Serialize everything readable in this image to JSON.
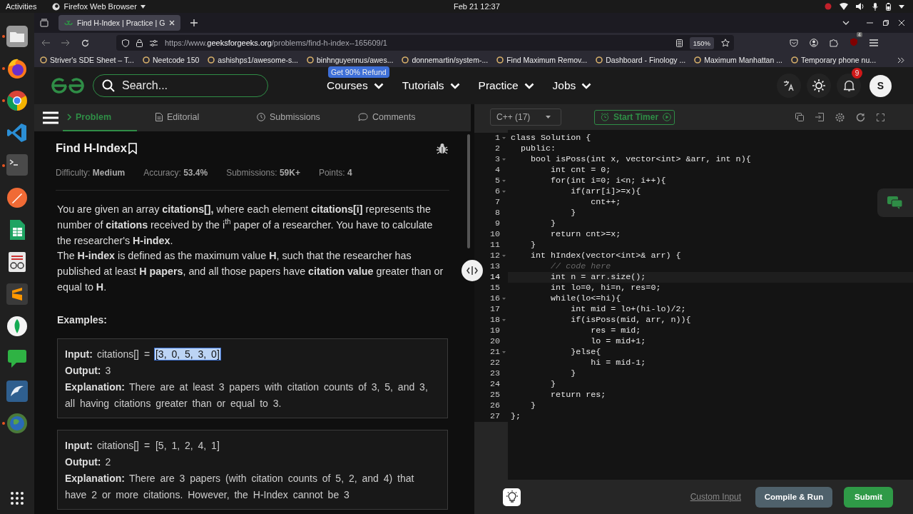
{
  "system_bar": {
    "activities": "Activities",
    "app_menu": "Firefox Web Browser",
    "clock": "Feb 21  12:37"
  },
  "dock": [
    {
      "kind": "folder",
      "running": true
    },
    {
      "kind": "flame",
      "running": true
    },
    {
      "kind": "wheel",
      "running": true
    },
    {
      "kind": "ribbon",
      "running": false
    },
    {
      "kind": "terminal",
      "running": true
    },
    {
      "kind": "rocket",
      "running": false
    },
    {
      "kind": "sheet",
      "running": false
    },
    {
      "kind": "glasses",
      "running": false
    },
    {
      "kind": "stripes",
      "running": false
    },
    {
      "kind": "leaf",
      "running": false
    },
    {
      "kind": "chat",
      "running": false
    },
    {
      "kind": "dolphin",
      "running": false
    },
    {
      "kind": "globe",
      "running": true
    }
  ],
  "browser": {
    "tab_title": "Find H-Index | Practice | G",
    "url_host": "https://www.",
    "url_domain": "geeksforgeeks.org",
    "url_path": "/problems/find-h-index--165609/1",
    "zoom": "150%",
    "extension_badge": "4",
    "bookmarks": [
      {
        "label": "Striver's SDE Sheet – T..."
      },
      {
        "label": "Neetcode 150"
      },
      {
        "label": "ashishps1/awesome-s..."
      },
      {
        "label": "binhnguyennus/awes..."
      },
      {
        "label": "donnemartin/system-..."
      },
      {
        "label": "Find Maximum Remov..."
      },
      {
        "label": "Dashboard - Finology ..."
      },
      {
        "label": "Maximum Manhattan ..."
      },
      {
        "label": "Temporary phone nu..."
      }
    ]
  },
  "site_header": {
    "search_placeholder": "Search...",
    "promo_badge": "Get 90% Refund",
    "nav": [
      "Courses",
      "Tutorials",
      "Practice",
      "Jobs"
    ],
    "notification_count": "9",
    "avatar": "S"
  },
  "problem_tabs": [
    {
      "label": "Problem",
      "selected": true
    },
    {
      "label": "Editorial",
      "selected": false
    },
    {
      "label": "Submissions",
      "selected": false
    },
    {
      "label": "Comments",
      "selected": false
    }
  ],
  "problem": {
    "title": "Find H-Index",
    "meta": [
      {
        "label": "Difficulty: ",
        "value": "Medium"
      },
      {
        "label": "Accuracy: ",
        "value": "53.4%"
      },
      {
        "label": "Submissions: ",
        "value": "59K+"
      },
      {
        "label": "Points: ",
        "value": "4"
      }
    ],
    "description": [
      "You are given an array **citations[],** where each element **citations[i]** represents the number of **citations** received by the i$^{th}$ paper of a researcher. You have to calculate the researcher's **H-index**.",
      "The **H-index** is defined as the maximum value **H**, such that the researcher has published at least **H papers**, and all those papers have **citation value** greater than or equal to **H**."
    ],
    "examples_heading": "Examples:",
    "examples": [
      {
        "input_label": "Input:",
        "input_prefix": "citations[] = ",
        "input_value": "[3, 0, 5, 3, 0]",
        "highlighted": true,
        "output_label": "Output:",
        "output": "3",
        "explanation_label": "Explanation:",
        "explanation": "There are at least 3 papers with citation counts of 3, 5, and 3, all having citations greater than or equal to 3."
      },
      {
        "input_label": "Input:",
        "input_prefix": "citations[] = ",
        "input_value": "[5, 1, 2, 4, 1]",
        "highlighted": false,
        "output_label": "Output:",
        "output": "2",
        "explanation_label": "Explanation:",
        "explanation": "There are 3 papers (with citation counts of 5, 2, and 4) that have 2 or more citations. However, the H-Index cannot be 3"
      }
    ]
  },
  "editor": {
    "language": "C++ (17)",
    "timer_button": "Start Timer",
    "lines": [
      {
        "number": "1",
        "text": "class Solution {",
        "kind": "code",
        "foldable": true,
        "current": false
      },
      {
        "number": "2",
        "text": "  public:",
        "kind": "code",
        "foldable": false,
        "current": false
      },
      {
        "number": "3",
        "text": "    bool isPoss(int x, vector<int> &arr, int n){",
        "kind": "code",
        "foldable": true,
        "current": false
      },
      {
        "number": "4",
        "text": "        int cnt = 0;",
        "kind": "code",
        "foldable": false,
        "current": false
      },
      {
        "number": "5",
        "text": "        for(int i=0; i<n; i++){",
        "kind": "code",
        "foldable": true,
        "current": false
      },
      {
        "number": "6",
        "text": "            if(arr[i]>=x){",
        "kind": "code",
        "foldable": true,
        "current": false
      },
      {
        "number": "7",
        "text": "                cnt++;",
        "kind": "code",
        "foldable": false,
        "current": false
      },
      {
        "number": "8",
        "text": "            }",
        "kind": "code",
        "foldable": false,
        "current": false
      },
      {
        "number": "9",
        "text": "        }",
        "kind": "code",
        "foldable": false,
        "current": false
      },
      {
        "number": "10",
        "text": "        return cnt>=x;",
        "kind": "code",
        "foldable": false,
        "current": false
      },
      {
        "number": "11",
        "text": "    }",
        "kind": "code",
        "foldable": false,
        "current": false
      },
      {
        "number": "12",
        "text": "    int hIndex(vector<int>& arr) {",
        "kind": "code",
        "foldable": true,
        "current": false
      },
      {
        "number": "13",
        "text": "        // code here",
        "kind": "comment",
        "foldable": false,
        "current": false
      },
      {
        "number": "14",
        "text": "        int n = arr.size();",
        "kind": "code",
        "foldable": false,
        "current": true
      },
      {
        "number": "15",
        "text": "        int lo=0, hi=n, res=0;",
        "kind": "code",
        "foldable": false,
        "current": false
      },
      {
        "number": "16",
        "text": "        while(lo<=hi){",
        "kind": "code",
        "foldable": true,
        "current": false
      },
      {
        "number": "17",
        "text": "            int mid = lo+(hi-lo)/2;",
        "kind": "code",
        "foldable": false,
        "current": false
      },
      {
        "number": "18",
        "text": "            if(isPoss(mid, arr, n)){",
        "kind": "code",
        "foldable": true,
        "current": false
      },
      {
        "number": "19",
        "text": "                res = mid;",
        "kind": "code",
        "foldable": false,
        "current": false
      },
      {
        "number": "20",
        "text": "                lo = mid+1;",
        "kind": "code",
        "foldable": false,
        "current": false
      },
      {
        "number": "21",
        "text": "            }else{",
        "kind": "code",
        "foldable": true,
        "current": false
      },
      {
        "number": "22",
        "text": "                hi = mid-1;",
        "kind": "code",
        "foldable": false,
        "current": false
      },
      {
        "number": "23",
        "text": "            }",
        "kind": "code",
        "foldable": false,
        "current": false
      },
      {
        "number": "24",
        "text": "        }",
        "kind": "code",
        "foldable": false,
        "current": false
      },
      {
        "number": "25",
        "text": "        return res;",
        "kind": "code",
        "foldable": false,
        "current": false
      },
      {
        "number": "26",
        "text": "    }",
        "kind": "code",
        "foldable": false,
        "current": false
      },
      {
        "number": "27",
        "text": "};",
        "kind": "code",
        "foldable": false,
        "current": false
      }
    ],
    "custom_input": "Custom Input",
    "compile_button": "Compile & Run",
    "submit_button": "Submit"
  }
}
